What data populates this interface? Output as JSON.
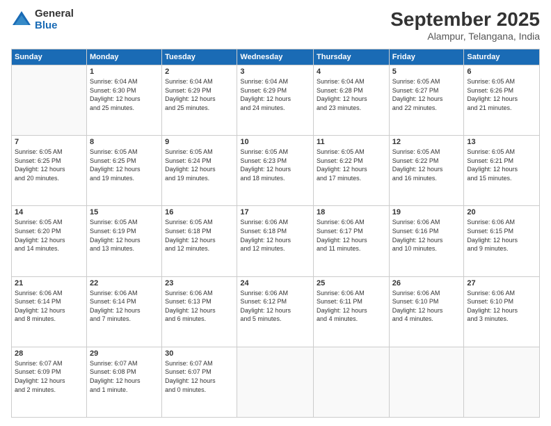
{
  "logo": {
    "general": "General",
    "blue": "Blue"
  },
  "title": "September 2025",
  "location": "Alampur, Telangana, India",
  "headers": [
    "Sunday",
    "Monday",
    "Tuesday",
    "Wednesday",
    "Thursday",
    "Friday",
    "Saturday"
  ],
  "weeks": [
    [
      {
        "day": "",
        "info": ""
      },
      {
        "day": "1",
        "info": "Sunrise: 6:04 AM\nSunset: 6:30 PM\nDaylight: 12 hours\nand 25 minutes."
      },
      {
        "day": "2",
        "info": "Sunrise: 6:04 AM\nSunset: 6:29 PM\nDaylight: 12 hours\nand 25 minutes."
      },
      {
        "day": "3",
        "info": "Sunrise: 6:04 AM\nSunset: 6:29 PM\nDaylight: 12 hours\nand 24 minutes."
      },
      {
        "day": "4",
        "info": "Sunrise: 6:04 AM\nSunset: 6:28 PM\nDaylight: 12 hours\nand 23 minutes."
      },
      {
        "day": "5",
        "info": "Sunrise: 6:05 AM\nSunset: 6:27 PM\nDaylight: 12 hours\nand 22 minutes."
      },
      {
        "day": "6",
        "info": "Sunrise: 6:05 AM\nSunset: 6:26 PM\nDaylight: 12 hours\nand 21 minutes."
      }
    ],
    [
      {
        "day": "7",
        "info": "Sunrise: 6:05 AM\nSunset: 6:25 PM\nDaylight: 12 hours\nand 20 minutes."
      },
      {
        "day": "8",
        "info": "Sunrise: 6:05 AM\nSunset: 6:25 PM\nDaylight: 12 hours\nand 19 minutes."
      },
      {
        "day": "9",
        "info": "Sunrise: 6:05 AM\nSunset: 6:24 PM\nDaylight: 12 hours\nand 19 minutes."
      },
      {
        "day": "10",
        "info": "Sunrise: 6:05 AM\nSunset: 6:23 PM\nDaylight: 12 hours\nand 18 minutes."
      },
      {
        "day": "11",
        "info": "Sunrise: 6:05 AM\nSunset: 6:22 PM\nDaylight: 12 hours\nand 17 minutes."
      },
      {
        "day": "12",
        "info": "Sunrise: 6:05 AM\nSunset: 6:22 PM\nDaylight: 12 hours\nand 16 minutes."
      },
      {
        "day": "13",
        "info": "Sunrise: 6:05 AM\nSunset: 6:21 PM\nDaylight: 12 hours\nand 15 minutes."
      }
    ],
    [
      {
        "day": "14",
        "info": "Sunrise: 6:05 AM\nSunset: 6:20 PM\nDaylight: 12 hours\nand 14 minutes."
      },
      {
        "day": "15",
        "info": "Sunrise: 6:05 AM\nSunset: 6:19 PM\nDaylight: 12 hours\nand 13 minutes."
      },
      {
        "day": "16",
        "info": "Sunrise: 6:05 AM\nSunset: 6:18 PM\nDaylight: 12 hours\nand 12 minutes."
      },
      {
        "day": "17",
        "info": "Sunrise: 6:06 AM\nSunset: 6:18 PM\nDaylight: 12 hours\nand 12 minutes."
      },
      {
        "day": "18",
        "info": "Sunrise: 6:06 AM\nSunset: 6:17 PM\nDaylight: 12 hours\nand 11 minutes."
      },
      {
        "day": "19",
        "info": "Sunrise: 6:06 AM\nSunset: 6:16 PM\nDaylight: 12 hours\nand 10 minutes."
      },
      {
        "day": "20",
        "info": "Sunrise: 6:06 AM\nSunset: 6:15 PM\nDaylight: 12 hours\nand 9 minutes."
      }
    ],
    [
      {
        "day": "21",
        "info": "Sunrise: 6:06 AM\nSunset: 6:14 PM\nDaylight: 12 hours\nand 8 minutes."
      },
      {
        "day": "22",
        "info": "Sunrise: 6:06 AM\nSunset: 6:14 PM\nDaylight: 12 hours\nand 7 minutes."
      },
      {
        "day": "23",
        "info": "Sunrise: 6:06 AM\nSunset: 6:13 PM\nDaylight: 12 hours\nand 6 minutes."
      },
      {
        "day": "24",
        "info": "Sunrise: 6:06 AM\nSunset: 6:12 PM\nDaylight: 12 hours\nand 5 minutes."
      },
      {
        "day": "25",
        "info": "Sunrise: 6:06 AM\nSunset: 6:11 PM\nDaylight: 12 hours\nand 4 minutes."
      },
      {
        "day": "26",
        "info": "Sunrise: 6:06 AM\nSunset: 6:10 PM\nDaylight: 12 hours\nand 4 minutes."
      },
      {
        "day": "27",
        "info": "Sunrise: 6:06 AM\nSunset: 6:10 PM\nDaylight: 12 hours\nand 3 minutes."
      }
    ],
    [
      {
        "day": "28",
        "info": "Sunrise: 6:07 AM\nSunset: 6:09 PM\nDaylight: 12 hours\nand 2 minutes."
      },
      {
        "day": "29",
        "info": "Sunrise: 6:07 AM\nSunset: 6:08 PM\nDaylight: 12 hours\nand 1 minute."
      },
      {
        "day": "30",
        "info": "Sunrise: 6:07 AM\nSunset: 6:07 PM\nDaylight: 12 hours\nand 0 minutes."
      },
      {
        "day": "",
        "info": ""
      },
      {
        "day": "",
        "info": ""
      },
      {
        "day": "",
        "info": ""
      },
      {
        "day": "",
        "info": ""
      }
    ]
  ]
}
